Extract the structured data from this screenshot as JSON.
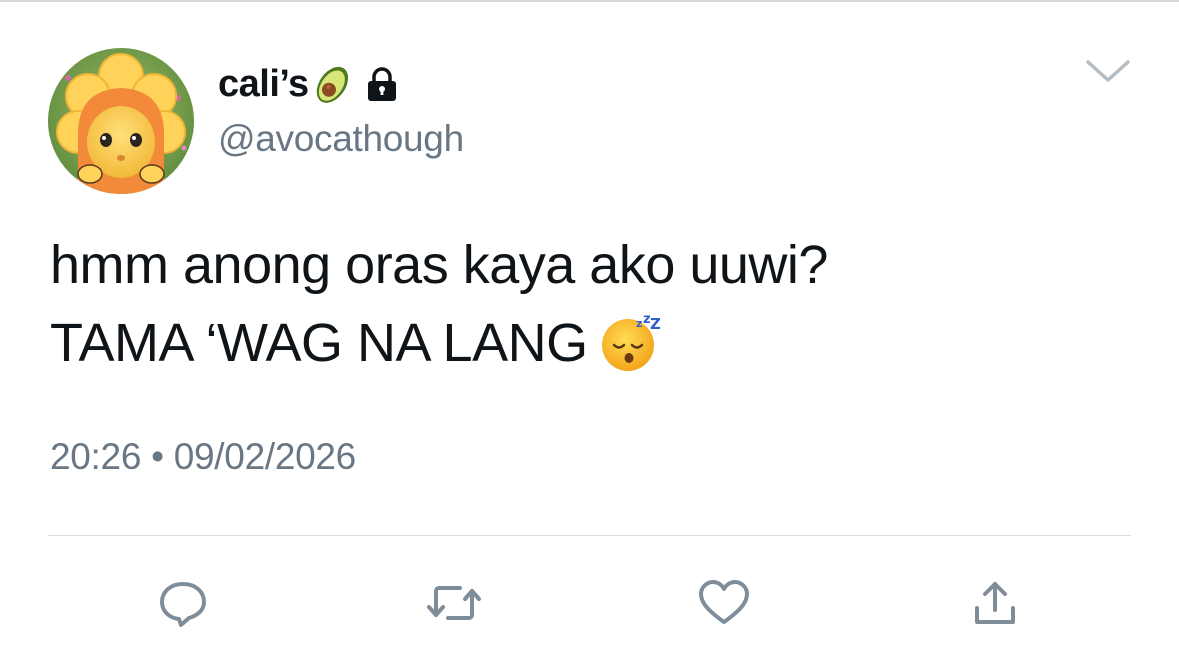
{
  "tweet": {
    "display_name": "cali’s",
    "handle": "@avocathough",
    "text_line_1": "hmm anong oras kaya ako uuwi?",
    "text_line_2": "TAMA ‘WAG NA LANG",
    "time": "20:26",
    "separator": "•",
    "date": "09/02/2026",
    "name_emoji": "avocado-emoji",
    "protected_badge": "lock-icon",
    "text_emoji": "sleeping-face-emoji"
  },
  "actions": [
    {
      "name": "reply",
      "icon": "reply-icon"
    },
    {
      "name": "retweet",
      "icon": "retweet-icon"
    },
    {
      "name": "like",
      "icon": "heart-icon"
    },
    {
      "name": "share",
      "icon": "share-icon"
    }
  ],
  "colors": {
    "text": "#0f1419",
    "secondary_text": "#697784",
    "icon": "#7f8d9a",
    "divider": "#d6dadd"
  }
}
